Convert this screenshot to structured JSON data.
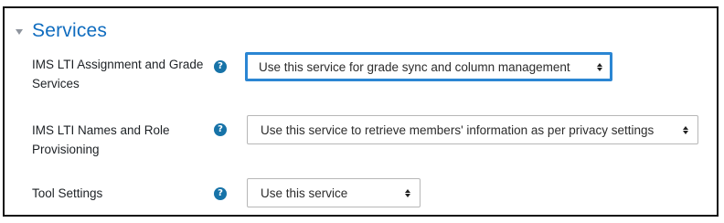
{
  "section": {
    "title": "Services",
    "collapse_icon": "caret-down-icon"
  },
  "services": [
    {
      "label": "IMS LTI Assignment and Grade Services",
      "help_icon": "question-circle-icon",
      "help_glyph": "?",
      "selected": "Use this service for grade sync and column management",
      "focused": true
    },
    {
      "label": "IMS LTI Names and Role Provisioning",
      "help_icon": "question-circle-icon",
      "help_glyph": "?",
      "selected": "Use this service to retrieve members' information as per privacy settings",
      "focused": false
    },
    {
      "label": "Tool Settings",
      "help_icon": "question-circle-icon",
      "help_glyph": "?",
      "selected": "Use this service",
      "focused": false
    }
  ],
  "colors": {
    "accent": "#0f6cbf",
    "help_icon": "#1773a8",
    "focus_ring": "#2b86d3",
    "border": "#111111"
  }
}
